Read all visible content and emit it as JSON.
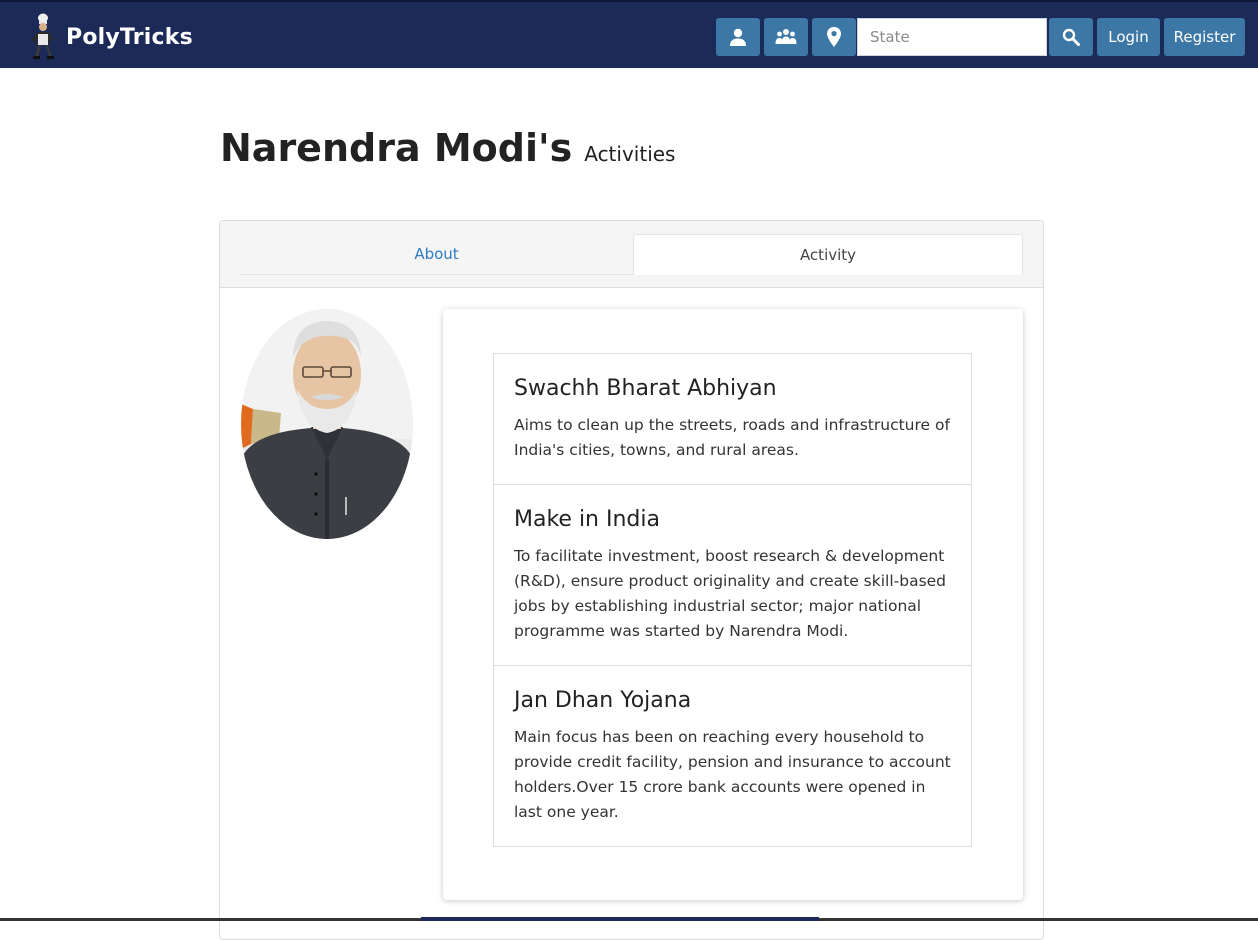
{
  "brand": {
    "name": "PolyTricks"
  },
  "nav": {
    "search_placeholder": "State",
    "login_label": "Login",
    "register_label": "Register",
    "icons": [
      "user-icon",
      "group-icon",
      "map-pin-icon",
      "search-icon"
    ]
  },
  "heading": {
    "name": "Narendra Modi's",
    "sub": "Activities"
  },
  "tabs": [
    {
      "label": "About"
    },
    {
      "label": "Activity"
    }
  ],
  "activities": [
    {
      "title": "Swachh Bharat Abhiyan",
      "text": "Aims to clean up the streets, roads and infrastructure of India's cities, towns, and rural areas."
    },
    {
      "title": "Make in India",
      "text": "To facilitate investment, boost research & development (R&D), ensure product originality and create skill-based jobs by establishing industrial sector; major national programme was started by Narendra Modi."
    },
    {
      "title": "Jan Dhan Yojana",
      "text": "Main focus has been on reaching every household to provide credit facility, pension and insurance to account holders.Over 15 crore bank accounts were opened in last one year."
    }
  ],
  "colors": {
    "navbar": "#1b2a57",
    "button": "#3c77a5",
    "tab_link": "#2d7cc1"
  }
}
